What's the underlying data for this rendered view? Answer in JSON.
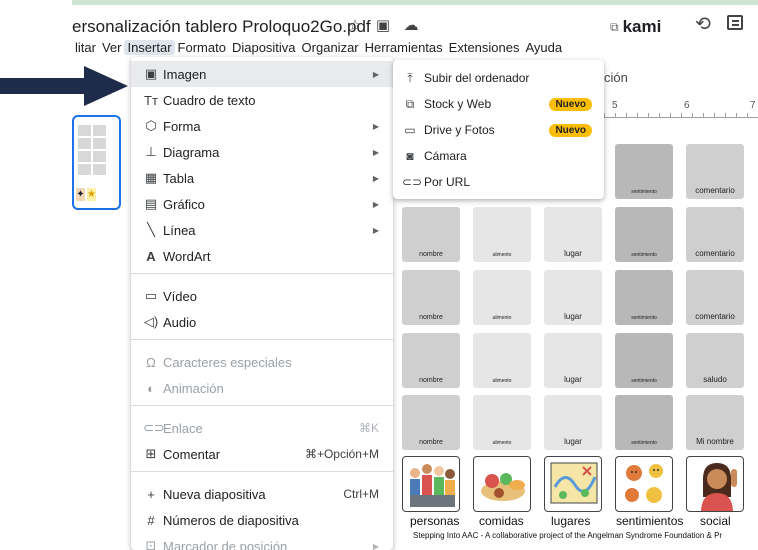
{
  "window": {
    "title": "ersonalización tablero Proloquo2Go.pdf",
    "kami_label": "kami"
  },
  "menubar": [
    "litar",
    "Ver",
    "Insertar",
    "Formato",
    "Diapositiva",
    "Organizar",
    "Herramientas",
    "Extensiones",
    "Ayuda"
  ],
  "toolbar": {
    "partial_label": "ción"
  },
  "ruler": {
    "numbers": [
      "5",
      "6",
      "7"
    ]
  },
  "insert_menu": {
    "items": [
      {
        "icon": "image-icon",
        "label": "Imagen",
        "shortcut": "",
        "submenu": true,
        "disabled": false,
        "hover": true
      },
      {
        "icon": "text-box-icon",
        "label": "Cuadro de texto",
        "shortcut": "",
        "submenu": false,
        "disabled": false
      },
      {
        "icon": "shape-icon",
        "label": "Forma",
        "shortcut": "",
        "submenu": true,
        "disabled": false
      },
      {
        "icon": "diagram-icon",
        "label": "Diagrama",
        "shortcut": "",
        "submenu": true,
        "disabled": false
      },
      {
        "icon": "table-icon",
        "label": "Tabla",
        "shortcut": "",
        "submenu": true,
        "disabled": false
      },
      {
        "icon": "chart-icon",
        "label": "Gráfico",
        "shortcut": "",
        "submenu": true,
        "disabled": false
      },
      {
        "icon": "line-icon",
        "label": "Línea",
        "shortcut": "",
        "submenu": true,
        "disabled": false
      },
      {
        "icon": "wordart-icon",
        "label": "WordArt",
        "shortcut": "",
        "submenu": false,
        "disabled": false
      },
      {
        "icon": "video-icon",
        "label": "Vídeo",
        "shortcut": "",
        "submenu": false,
        "disabled": false
      },
      {
        "icon": "audio-icon",
        "label": "Audio",
        "shortcut": "",
        "submenu": false,
        "disabled": false
      },
      {
        "icon": "omega-icon",
        "label": "Caracteres especiales",
        "shortcut": "",
        "submenu": false,
        "disabled": true
      },
      {
        "icon": "animation-icon",
        "label": "Animación",
        "shortcut": "",
        "submenu": false,
        "disabled": true
      },
      {
        "icon": "link-icon",
        "label": "Enlace",
        "shortcut": "⌘K",
        "submenu": false,
        "disabled": true
      },
      {
        "icon": "comment-add-icon",
        "label": "Comentar",
        "shortcut": "⌘+Opción+M",
        "submenu": false,
        "disabled": false
      },
      {
        "icon": "plus-icon",
        "label": "Nueva diapositiva",
        "shortcut": "Ctrl+M",
        "submenu": false,
        "disabled": false
      },
      {
        "icon": "hash-icon",
        "label": "Números de diapositiva",
        "shortcut": "",
        "submenu": false,
        "disabled": false
      },
      {
        "icon": "placeholder-icon",
        "label": "Marcador de posición",
        "shortcut": "",
        "submenu": true,
        "disabled": true
      }
    ]
  },
  "image_submenu": {
    "items": [
      {
        "icon": "upload-icon",
        "label": "Subir del ordenador",
        "badge": ""
      },
      {
        "icon": "stock-web-icon",
        "label": "Stock y Web",
        "badge": "Nuevo"
      },
      {
        "icon": "folder-icon",
        "label": "Drive y Fotos",
        "badge": "Nuevo"
      },
      {
        "icon": "camera-icon",
        "label": "Cámara",
        "badge": ""
      },
      {
        "icon": "link-icon",
        "label": "Por URL",
        "badge": ""
      }
    ]
  },
  "slide": {
    "rows": [
      [
        "",
        "",
        "",
        "sentimiento",
        "comentario"
      ],
      [
        "nombre",
        "alimento",
        "lugar",
        "sentimiento",
        "comentario"
      ],
      [
        "nombre",
        "alimento",
        "lugar",
        "sentimiento",
        "comentario"
      ],
      [
        "nombre",
        "alimento",
        "lugar",
        "sentimiento",
        "saludo"
      ],
      [
        "nombre",
        "alimento",
        "lugar",
        "sentimiento",
        "Mi nombre"
      ]
    ],
    "pictograms": [
      "personas",
      "comidas",
      "lugares",
      "sentimientos",
      "social"
    ],
    "footer": "Stepping Into AAC - A collaborative project of the Angelman Syndrome Foundation & Pr"
  },
  "colors": {
    "selection_blue": "#1a73e8",
    "arrow_navy": "#1f2b4a",
    "badge_yellow": "#fbbc04"
  }
}
